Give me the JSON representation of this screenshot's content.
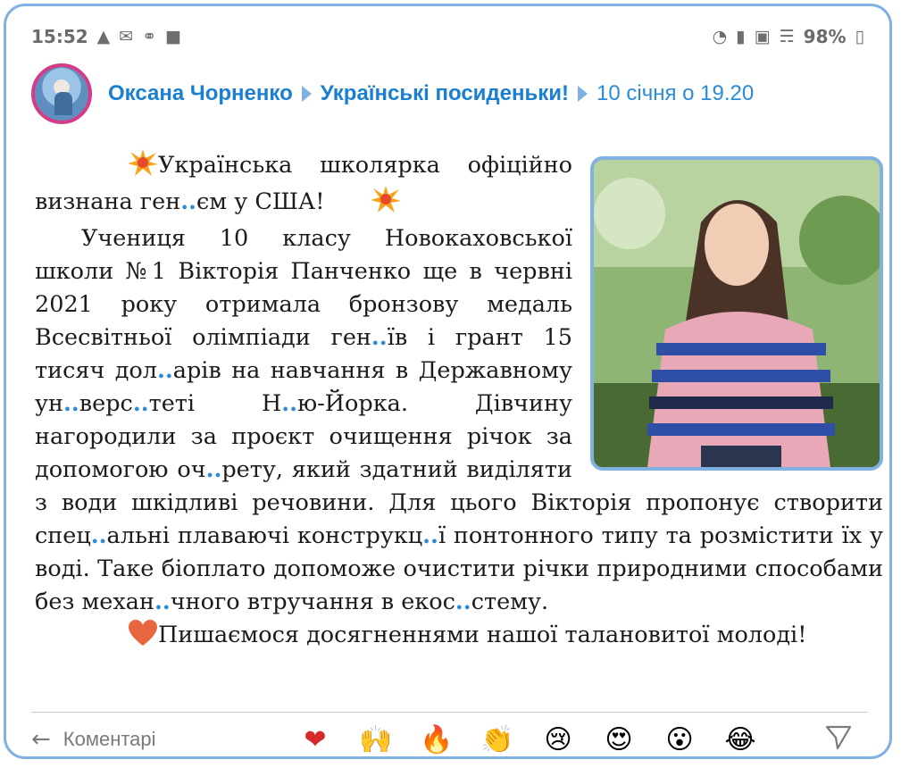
{
  "status_bar": {
    "time": "15:52",
    "battery": "98%",
    "icons_left": [
      "accessibility-icon",
      "mail-icon",
      "globe-icon",
      "chat-icon"
    ],
    "icons_right": [
      "headphones-icon",
      "signal-icon",
      "image-icon",
      "wifi-icon",
      "battery-icon"
    ]
  },
  "header": {
    "author": "Оксана Чорненко",
    "group": "Українські посиденьки!",
    "date": "10 січня о 19.20"
  },
  "post": {
    "line1": "Українська школярка офіцій­но визнана ген",
    "line1_after": "єм у США!",
    "para2": [
      {
        "t": "Учениця 10 класу Новокаховської школи №1 Вікторія Панченко ще в червні 2021 року отримала бронзову медаль Всесвітньої олімпіади ген"
      },
      {
        "d": ".."
      },
      {
        "t": "їв і грант 15 тисяч дол"
      },
      {
        "d": ".."
      },
      {
        "t": "арів на нав­чання в Державному ун"
      },
      {
        "d": ".."
      },
      {
        "t": "верс"
      },
      {
        "d": ".."
      },
      {
        "t": "теті Н"
      },
      {
        "d": ".."
      },
      {
        "t": "ю-Йорка. Дівчину нагородили за проєкт очищення річок за допо­могою оч"
      },
      {
        "d": ".."
      },
      {
        "t": "рету, який здатний виділяти з води шкідливі речовини. Для цього Вікторія пропонує створити спец"
      },
      {
        "d": ".."
      },
      {
        "t": "альні плаваючі конструкц"
      },
      {
        "d": ".."
      },
      {
        "t": "ї понтонного типу та розмістити їх у воді. Таке біоплато допоможе очистити річки природними способами без механ"
      },
      {
        "d": ".."
      },
      {
        "t": "чного втручання в екос"
      },
      {
        "d": ".."
      },
      {
        "t": "стему."
      }
    ],
    "dots": "..",
    "closing": "Пишаємося досягненнями нашої талановитої молоді!"
  },
  "footer": {
    "comment_label": "Коментарі",
    "reactions": [
      {
        "name": "heart-reaction",
        "glyph": "❤"
      },
      {
        "name": "raised-hands-reaction",
        "glyph": "🙌"
      },
      {
        "name": "fire-reaction",
        "glyph": "🔥"
      },
      {
        "name": "clap-reaction",
        "glyph": "👏"
      },
      {
        "name": "crying-face-reaction",
        "glyph": "😢"
      },
      {
        "name": "heart-eyes-reaction",
        "glyph": "😍"
      },
      {
        "name": "surprised-face-reaction",
        "glyph": "😮"
      },
      {
        "name": "laughing-face-reaction",
        "glyph": "😂"
      }
    ]
  },
  "colors": {
    "accent": "#2a8bd9",
    "frame": "#7fb2e3",
    "avatar_ring": "#d63b86"
  }
}
